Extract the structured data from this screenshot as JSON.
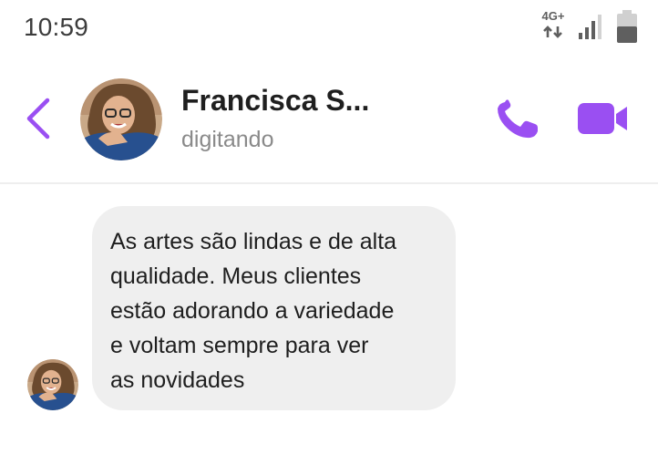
{
  "status_bar": {
    "time": "10:59",
    "network_label": "4G+",
    "icons": [
      "network-4g-icon",
      "signal-icon",
      "battery-icon"
    ]
  },
  "header": {
    "contact_name": "Francisca S...",
    "contact_status": "digitando",
    "icons": [
      "back-arrow-icon",
      "phone-icon",
      "video-camera-icon"
    ]
  },
  "messages": [
    {
      "sender": "contact",
      "text": "As artes são lindas e de alta\nqualidade. Meus clientes\nestão adorando a variedade\ne voltam sempre para ver\nas novidades"
    }
  ],
  "colors": {
    "accent": "#9a4ff2",
    "bubble": "#efefef",
    "text": "#1e1e1e",
    "secondary_text": "#8a8a8a",
    "divider": "#eeeeee"
  }
}
